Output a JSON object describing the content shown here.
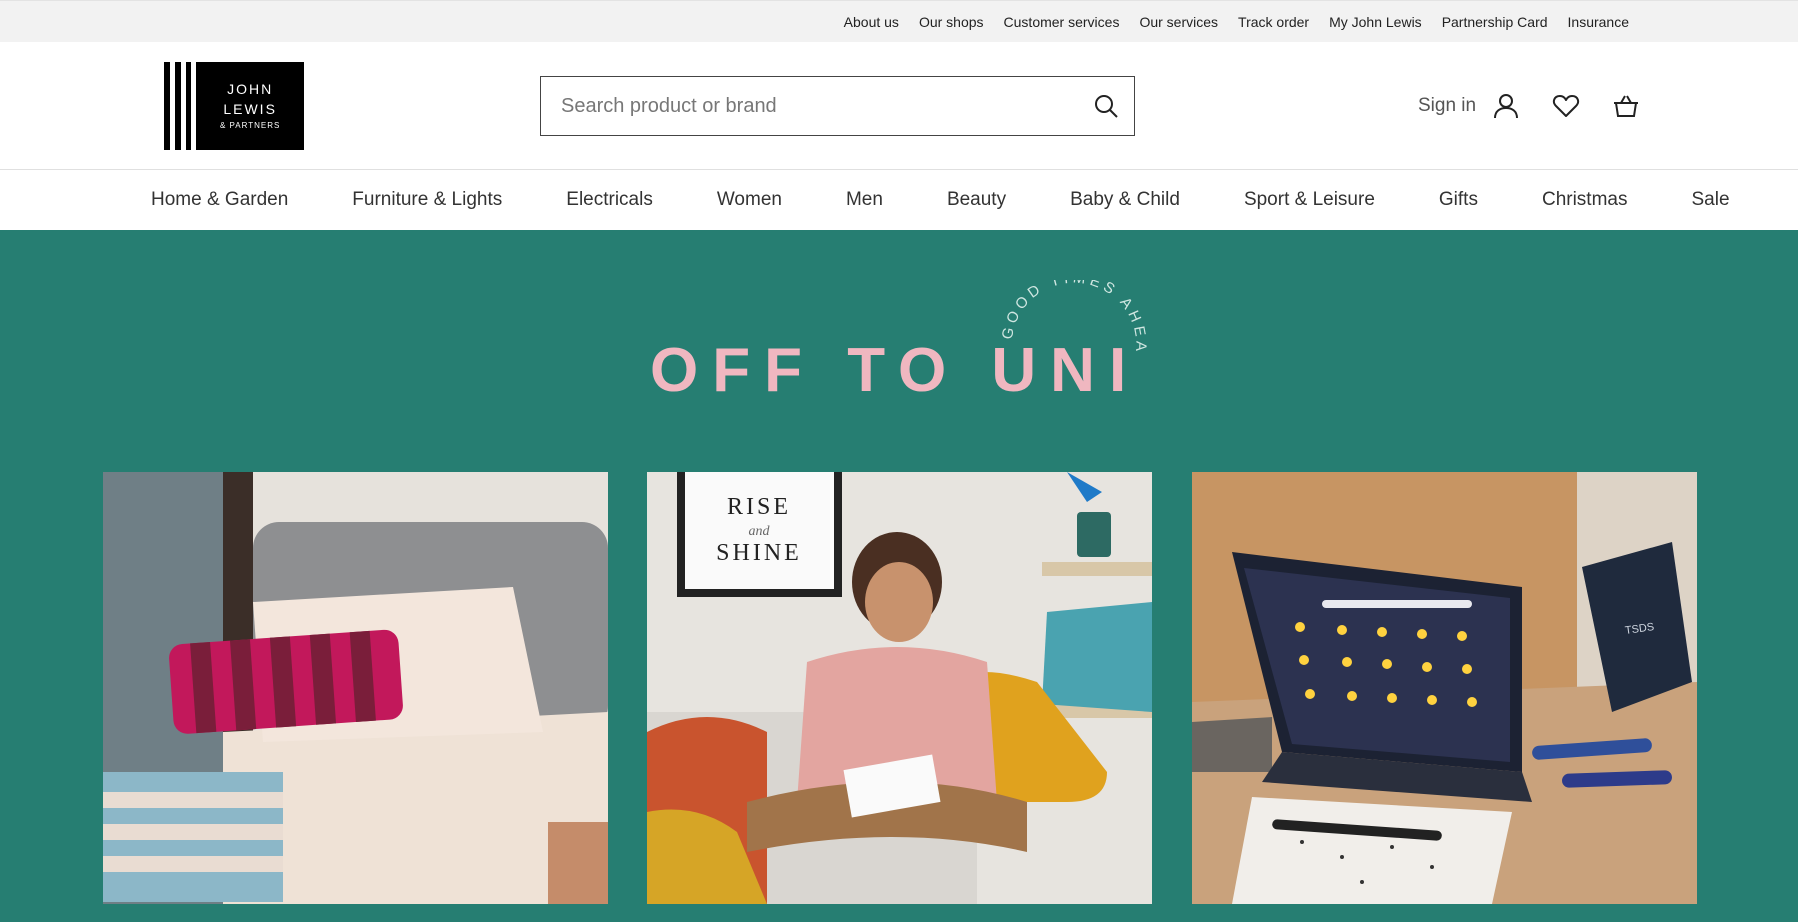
{
  "utility_nav": [
    "About us",
    "Our shops",
    "Customer services",
    "Our services",
    "Track order",
    "My John Lewis",
    "Partnership Card",
    "Insurance"
  ],
  "logo": {
    "line1": "JOHN",
    "line2": "LEWIS",
    "line3": "& PARTNERS"
  },
  "search": {
    "placeholder": "Search product or brand",
    "icon": "search-icon"
  },
  "account": {
    "signin_label": "Sign in",
    "icons": [
      "user-icon",
      "heart-icon",
      "basket-icon"
    ]
  },
  "main_nav": [
    "Home & Garden",
    "Furniture & Lights",
    "Electricals",
    "Women",
    "Men",
    "Beauty",
    "Baby & Child",
    "Sport & Leisure",
    "Gifts",
    "Christmas",
    "Sale"
  ],
  "hero": {
    "title": "OFF TO UNI",
    "arc_text": "GOOD TIMES AHEAD",
    "poster_line1": "RISE",
    "poster_line2": "and",
    "poster_line3": "SHINE",
    "laptop_brand": "TSDS"
  },
  "colors": {
    "hero_bg": "#267e72",
    "hero_title": "#f0b7c0",
    "arc_text": "#cfe6e1",
    "utility_bg": "#f2f2f2"
  }
}
